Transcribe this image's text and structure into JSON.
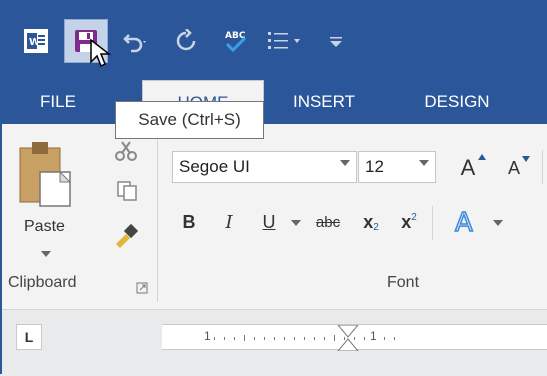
{
  "qat": {
    "word_icon": "word-app-icon",
    "save_icon": "save-icon",
    "undo_icon": "undo-icon",
    "redo_icon": "redo-icon",
    "spelling_icon_label": "ABC",
    "bullets_icon": "bullets-icon",
    "customize_icon": "customize-qat-icon"
  },
  "tooltip": "Save (Ctrl+S)",
  "tabs": {
    "file": "FILE",
    "home": "HOME",
    "insert": "INSERT",
    "design": "DESIGN"
  },
  "clipboard": {
    "paste_label": "Paste",
    "group_label": "Clipboard"
  },
  "font": {
    "name": "Segoe UI",
    "size": "12",
    "group_label": "Font",
    "bold": "B",
    "italic": "I",
    "underline": "U",
    "strikethrough": "abc",
    "subscript_base": "x",
    "subscript_mark": "2",
    "superscript_base": "x",
    "superscript_mark": "2",
    "grow": "A",
    "shrink": "A",
    "effects": "A"
  },
  "ruler": {
    "tab_selector": "L",
    "left_number": "1",
    "right_number": "1"
  },
  "colors": {
    "accent": "#2b579a",
    "ribbon": "#f3f3f3"
  }
}
